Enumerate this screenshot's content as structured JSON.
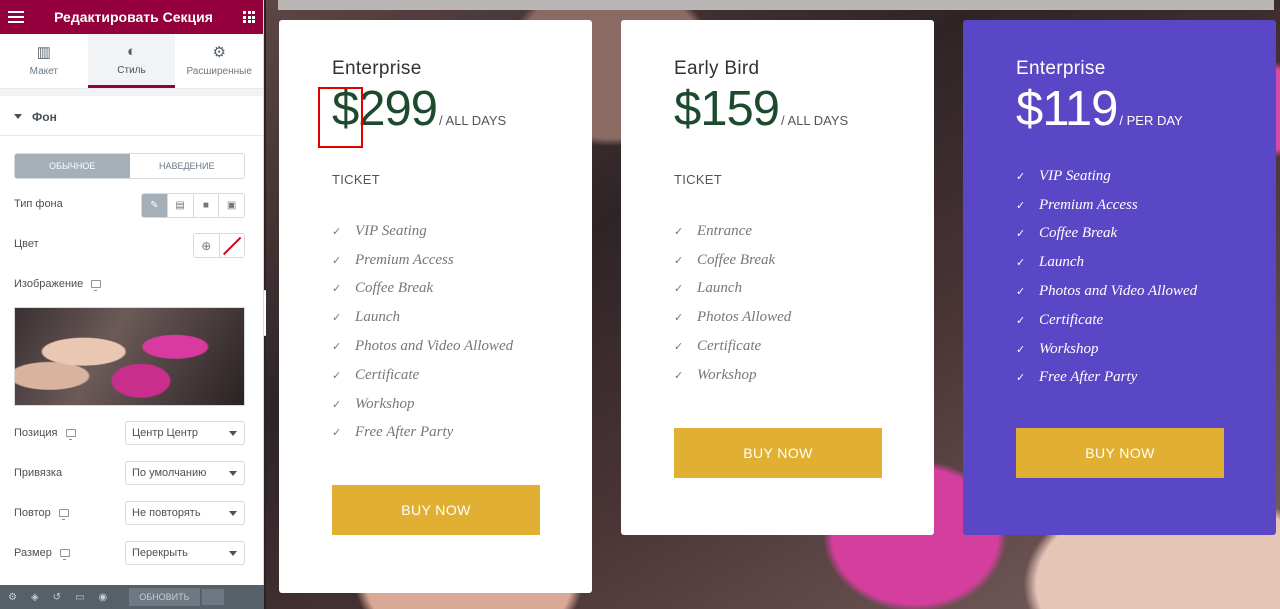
{
  "sidebar": {
    "title": "Редактировать Секция",
    "tabs": [
      {
        "label": "Макет",
        "icon": "layout-icon"
      },
      {
        "label": "Стиль",
        "icon": "style-icon"
      },
      {
        "label": "Расширенные",
        "icon": "gear-icon"
      }
    ],
    "section_title": "Фон",
    "state_toggle": {
      "normal": "ОБЫЧНОЕ",
      "hover": "НАВЕДЕНИЕ"
    },
    "bg_type_label": "Тип фона",
    "color_label": "Цвет",
    "image_label": "Изображение",
    "position": {
      "label": "Позиция",
      "value": "Центр Центр"
    },
    "attachment": {
      "label": "Привязка",
      "value": "По умолчанию"
    },
    "repeat": {
      "label": "Повтор",
      "value": "Не повторять"
    },
    "size": {
      "label": "Размер",
      "value": "Перекрыть"
    },
    "footer": {
      "update_label": "ОБНОВИТЬ"
    }
  },
  "cards": [
    {
      "name": "Enterprise",
      "price": "$299",
      "period": "/ ALL DAYS",
      "ticket": "TICKET",
      "features": [
        "VIP Seating",
        "Premium Access",
        "Coffee Break",
        "Launch",
        "Photos and Video Allowed",
        "Certificate",
        "Workshop",
        "Free After Party"
      ],
      "button": "BUY NOW"
    },
    {
      "name": "Early Bird",
      "price": "$159",
      "period": "/ ALL DAYS",
      "ticket": "TICKET",
      "features": [
        "Entrance",
        "Coffee Break",
        "Launch",
        "Photos Allowed",
        "Certificate",
        "Workshop"
      ],
      "button": "BUY NOW"
    },
    {
      "name": "Enterprise",
      "price": "$119",
      "period": "/ PER DAY",
      "features": [
        "VIP Seating",
        "Premium Access",
        "Coffee Break",
        "Launch",
        "Photos and Video Allowed",
        "Certificate",
        "Workshop",
        "Free After Party"
      ],
      "button": "BUY NOW"
    }
  ],
  "colors": {
    "sidebar_header": "#93003c",
    "button": "#e1b033",
    "featured_card": "#5a47c6",
    "price_text": "#1d4a2c",
    "highlight_box": "#e00000"
  }
}
